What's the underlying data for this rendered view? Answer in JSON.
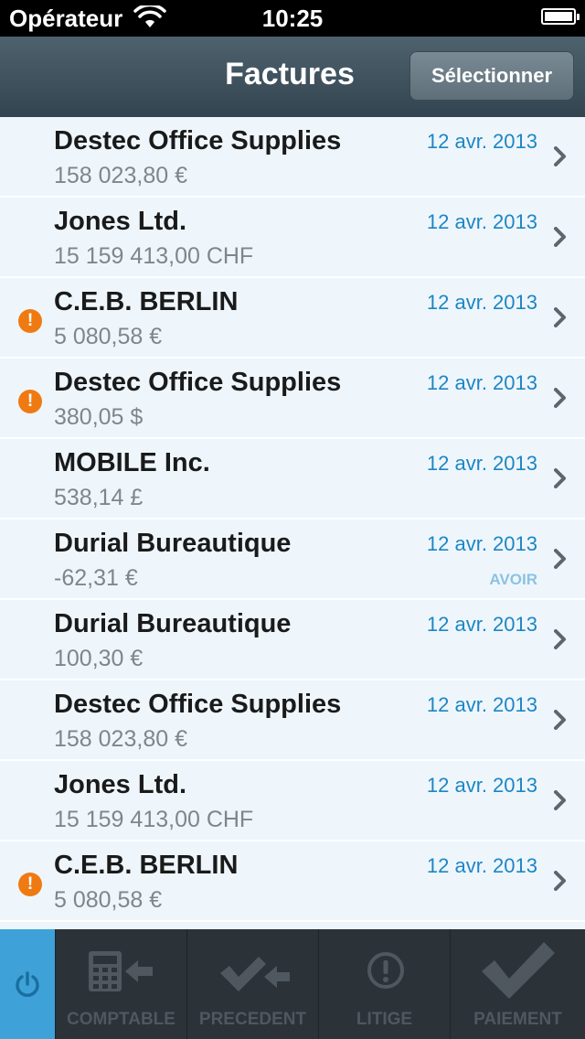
{
  "status_bar": {
    "carrier": "Opérateur",
    "time": "10:25"
  },
  "nav": {
    "title": "Factures",
    "select_label": "Sélectionner"
  },
  "invoices": [
    {
      "name": "Destec Office Supplies",
      "amount": "158 023,80 €",
      "date": "12 avr. 2013",
      "alert": false,
      "badge": ""
    },
    {
      "name": "Jones Ltd.",
      "amount": "15 159 413,00 CHF",
      "date": "12 avr. 2013",
      "alert": false,
      "badge": ""
    },
    {
      "name": "C.E.B. BERLIN",
      "amount": "5 080,58 €",
      "date": "12 avr. 2013",
      "alert": true,
      "badge": ""
    },
    {
      "name": "Destec Office Supplies",
      "amount": "380,05 $",
      "date": "12 avr. 2013",
      "alert": true,
      "badge": ""
    },
    {
      "name": "MOBILE Inc.",
      "amount": "538,14 £",
      "date": "12 avr. 2013",
      "alert": false,
      "badge": ""
    },
    {
      "name": "Durial Bureautique",
      "amount": "-62,31 €",
      "date": "12 avr. 2013",
      "alert": false,
      "badge": "AVOIR"
    },
    {
      "name": "Durial Bureautique",
      "amount": "100,30 €",
      "date": "12 avr. 2013",
      "alert": false,
      "badge": ""
    },
    {
      "name": "Destec Office Supplies",
      "amount": "158 023,80 €",
      "date": "12 avr. 2013",
      "alert": false,
      "badge": ""
    },
    {
      "name": "Jones Ltd.",
      "amount": "15 159 413,00 CHF",
      "date": "12 avr. 2013",
      "alert": false,
      "badge": ""
    },
    {
      "name": "C.E.B. BERLIN",
      "amount": "5 080,58 €",
      "date": "12 avr. 2013",
      "alert": true,
      "badge": ""
    }
  ],
  "alert_glyph": "!",
  "tabs": [
    {
      "label": "COMPTABLE",
      "icon": "calculator-arrow-icon"
    },
    {
      "label": "PRECEDENT",
      "icon": "check-arrow-icon"
    },
    {
      "label": "LITIGE",
      "icon": "exclamation-circle-icon"
    },
    {
      "label": "PAIEMENT",
      "icon": "checkmark-icon"
    }
  ],
  "colors": {
    "accent": "#1d86c4",
    "alert": "#f07a12",
    "power_tab": "#3ea2d8",
    "nav": "#3b4d58"
  }
}
